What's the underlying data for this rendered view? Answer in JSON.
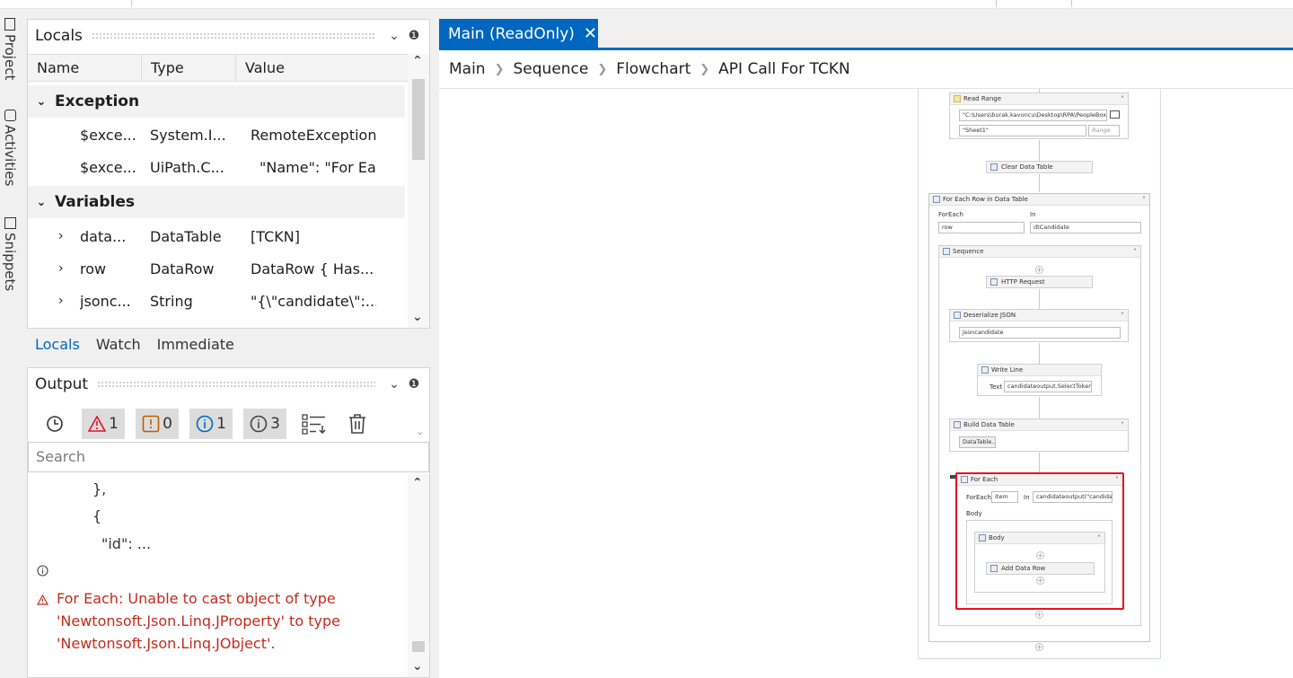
{
  "sidebar": {
    "tabs": [
      "Project",
      "Activities",
      "Snippets"
    ]
  },
  "locals": {
    "title": "Locals",
    "columns": [
      "Name",
      "Type",
      "Value"
    ],
    "groups": [
      {
        "label": "Exception",
        "rows": [
          {
            "name": "$exce...",
            "type": "System.I...",
            "value": "RemoteException"
          },
          {
            "name": "$exce...",
            "type": "UiPath.C...",
            "value": "\"Name\": \"For Ea"
          }
        ]
      },
      {
        "label": "Variables",
        "rows": [
          {
            "name": "data...",
            "type": "DataTable",
            "value": "[TCKN]"
          },
          {
            "name": "row",
            "type": "DataRow",
            "value": "DataRow { Has..."
          },
          {
            "name": "jsonc...",
            "type": "String",
            "value": "\"{\\\"candidate\\\":..."
          }
        ]
      }
    ],
    "bottom_tabs": [
      "Locals",
      "Watch",
      "Immediate"
    ]
  },
  "output": {
    "title": "Output",
    "counts": {
      "errors": "1",
      "warnings": "0",
      "info": "1",
      "trace": "3"
    },
    "search_placeholder": "Search",
    "lines": [
      "},",
      "{",
      "\"id\": ..."
    ],
    "error_lines": [
      "For Each: Unable to cast object of type",
      "'Newtonsoft.Json.Linq.JProperty' to type",
      "'Newtonsoft.Json.Linq.JObject'."
    ]
  },
  "designer": {
    "tab_label": "Main (ReadOnly)",
    "breadcrumb": [
      "Main",
      "Sequence",
      "Flowchart",
      "API Call For TCKN"
    ],
    "read_range": {
      "title": "Read Range",
      "path": "\"C:\\Users\\burak.kavuncu\\Desktop\\RPA\\PeopleBox",
      "sheet": "\"Sheet1\"",
      "range_placeholder": "Range"
    },
    "clear_table": "Clear Data Table",
    "for_each_row": {
      "title": "For Each Row in Data Table",
      "foreach_label": "ForEach",
      "in_label": "In",
      "item": "row",
      "collection": "dtCandidate"
    },
    "sequence_title": "Sequence",
    "http_request": "HTTP Request",
    "deserialize": {
      "title": "Deserialize JSON",
      "value": "jsoncandidate"
    },
    "write_line": {
      "title": "Write Line",
      "text_label": "Text",
      "value": "candidateoutput.SelectToken"
    },
    "build_table": {
      "title": "Build Data Table",
      "button": "DataTable..."
    },
    "for_each": {
      "title": "For Each",
      "foreach_label": "ForEach",
      "item": "item",
      "in_label": "In",
      "collection": "candidateoutput(\"candida",
      "body_label": "Body"
    },
    "body_title": "Body",
    "add_row": "Add Data Row",
    "colors": {
      "accent": "#0067c0",
      "error": "#e81123"
    }
  }
}
